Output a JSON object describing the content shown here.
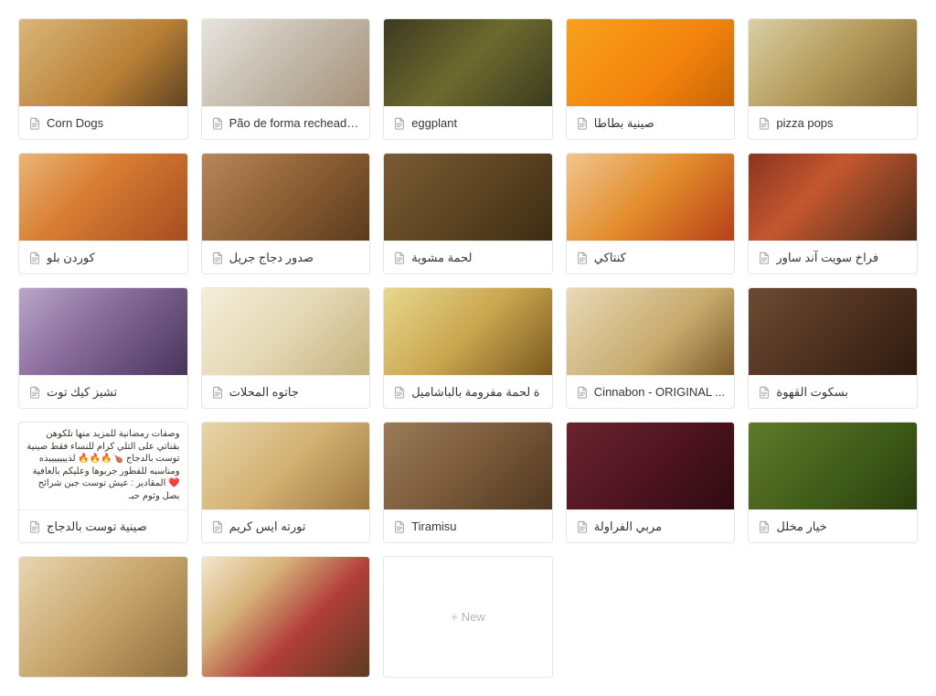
{
  "cards": [
    {
      "title": "Corn Dogs",
      "thumb_class": "t1"
    },
    {
      "title": "Pão de forma recheado...",
      "thumb_class": "t2",
      "truncated": true
    },
    {
      "title": "eggplant",
      "thumb_class": "t3"
    },
    {
      "title": "صينية بطاطا",
      "thumb_class": "t4"
    },
    {
      "title": "pizza pops",
      "thumb_class": "t5"
    },
    {
      "title": "كوردن بلو",
      "thumb_class": "t6"
    },
    {
      "title": "صدور دجاج جريل",
      "thumb_class": "t7"
    },
    {
      "title": "لحمة مشوية",
      "thumb_class": "t8"
    },
    {
      "title": "كنتاكي",
      "thumb_class": "t9"
    },
    {
      "title": "فراخ سويت آند ساور",
      "thumb_class": "t10"
    },
    {
      "title": "تشيز كيك توت",
      "thumb_class": "t11"
    },
    {
      "title": "جاتوه المحلات",
      "thumb_class": "t12"
    },
    {
      "title": "ة لحمة مفرومة بالباشاميل",
      "thumb_class": "t13",
      "truncated": true
    },
    {
      "title": "Cinnabon - ORIGINAL ...",
      "thumb_class": "t14",
      "truncated": true
    },
    {
      "title": "بسكوت القهوة",
      "thumb_class": "t15"
    },
    {
      "title": "صينية توست بالدجاج",
      "thumb_class": "",
      "text_preview": "وصفات رمضانية للمزيد منها تلكوهن بقناتي على التلي كرام  للنساء فقط\nصينية توست بالدجاج 🍗🔥🔥🔥\nلذيييييييذه ومناسبه للفطور جربوها وعليكم بالعافية ❤️ المقادير : عيش توست جبن شرائح بصل وثوم حبـ"
    },
    {
      "title": "تورته ايس كريم",
      "thumb_class": "t17"
    },
    {
      "title": "Tiramisu",
      "thumb_class": "t18"
    },
    {
      "title": "مربي الفراولة",
      "thumb_class": "t19"
    },
    {
      "title": "خيار مخلل",
      "thumb_class": "t20"
    },
    {
      "title": "",
      "thumb_class": "t21",
      "no_label": true
    },
    {
      "title": "",
      "thumb_class": "t22",
      "no_label": true
    }
  ],
  "new_button_label": "New"
}
